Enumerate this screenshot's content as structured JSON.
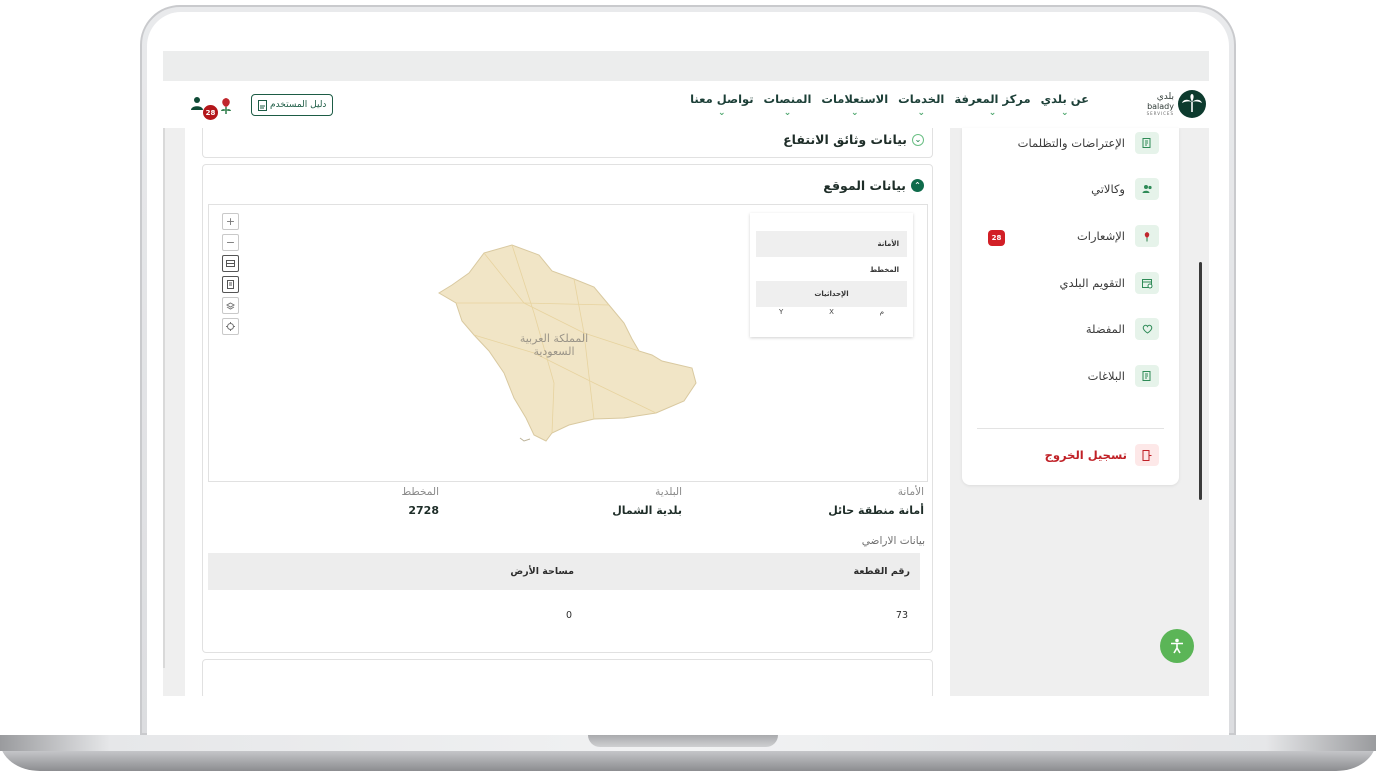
{
  "brand": {
    "wordmark": "بلدي",
    "latin": "balady",
    "latin_sub": "SERVICES"
  },
  "nav": {
    "items": [
      {
        "label": "عن بلدي"
      },
      {
        "label": "مركز المعرفة"
      },
      {
        "label": "الخدمات"
      },
      {
        "label": "الاستعلامات"
      },
      {
        "label": "المنصات"
      },
      {
        "label": "تواصل معنا"
      }
    ],
    "chevron": "⌄",
    "guide_label": "دليل المستخدم",
    "notifications_count": "28"
  },
  "sidebar": {
    "items": [
      {
        "label": "الإعتراضات والتظلمات",
        "icon": "document-icon"
      },
      {
        "label": "وكالاتي",
        "icon": "users-icon"
      },
      {
        "label": "الإشعارات",
        "icon": "bell-icon",
        "badge": "28"
      },
      {
        "label": "التقويم البلدي",
        "icon": "calendar-icon"
      },
      {
        "label": "المفضلة",
        "icon": "heart-icon"
      },
      {
        "label": "البلاغات",
        "icon": "report-icon"
      }
    ],
    "logout_label": "تسجيل الخروج"
  },
  "docs_card": {
    "title": "بيانات وثائق الانتفاع"
  },
  "site_card": {
    "title": "بيانات الموقع",
    "map": {
      "country_label_line1": "المملكة العربية",
      "country_label_line2": "السعودية",
      "tools": [
        "+",
        "−"
      ]
    },
    "info_panel": {
      "amanah_label": "الأمانة",
      "plan_label": "المخطط",
      "coords_label": "الإحداثيات",
      "coord_cols": [
        "م",
        "X",
        "Y"
      ]
    },
    "fields": {
      "amanah": {
        "label": "الأمانة",
        "value": "أمانة منطقة حائل"
      },
      "baladiya": {
        "label": "البلدية",
        "value": "بلدية الشمال"
      },
      "plan": {
        "label": "المخطط",
        "value": "2728"
      }
    },
    "land": {
      "title": "بيانات الاراضي",
      "headers": [
        "رقم القطعة",
        "مساحة الأرض"
      ],
      "rows": [
        [
          "73",
          "0"
        ]
      ]
    }
  },
  "colors": {
    "primary": "#0f6b4b",
    "accent_green": "#4aa56b",
    "danger": "#d21f26",
    "map_land": "#f1e5c6"
  }
}
